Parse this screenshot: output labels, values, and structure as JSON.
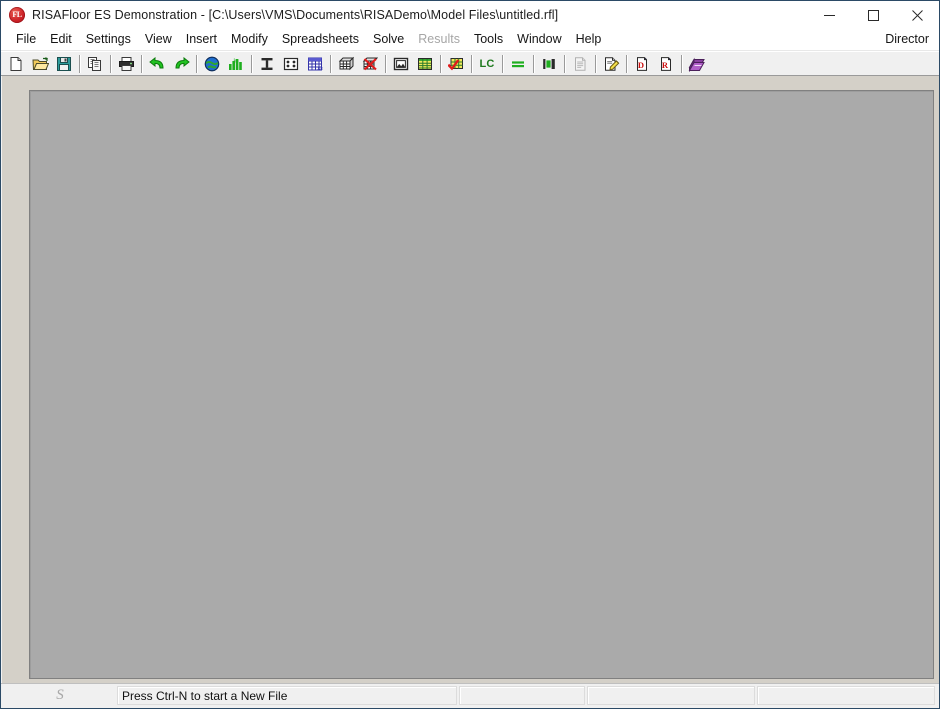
{
  "window": {
    "title": "RISAFloor ES Demonstration - [C:\\Users\\VMS\\Documents\\RISADemo\\Model Files\\untitled.rfl]",
    "logo_text": "FL",
    "controls": [
      {
        "name": "minimize-button",
        "label": "Minimize"
      },
      {
        "name": "maximize-button",
        "label": "Maximize"
      },
      {
        "name": "close-button",
        "label": "Close"
      }
    ]
  },
  "menu": {
    "items": [
      {
        "label": "File",
        "disabled": false
      },
      {
        "label": "Edit",
        "disabled": false
      },
      {
        "label": "Settings",
        "disabled": false
      },
      {
        "label": "View",
        "disabled": false
      },
      {
        "label": "Insert",
        "disabled": false
      },
      {
        "label": "Modify",
        "disabled": false
      },
      {
        "label": "Spreadsheets",
        "disabled": false
      },
      {
        "label": "Solve",
        "disabled": false
      },
      {
        "label": "Results",
        "disabled": true
      },
      {
        "label": "Tools",
        "disabled": false
      },
      {
        "label": "Window",
        "disabled": false
      },
      {
        "label": "Help",
        "disabled": false
      }
    ],
    "right_label": "Director"
  },
  "toolbar": {
    "buttons": [
      {
        "icon": "new-file-icon",
        "label": "New File"
      },
      {
        "icon": "open-folder-icon",
        "label": "Open File"
      },
      {
        "icon": "save-icon",
        "label": "Save File"
      },
      {
        "sep": true
      },
      {
        "icon": "copy-icon",
        "label": "Copy"
      },
      {
        "sep": true
      },
      {
        "icon": "print-icon",
        "label": "Print"
      },
      {
        "sep": true
      },
      {
        "icon": "undo-icon",
        "label": "Undo"
      },
      {
        "icon": "redo-icon",
        "label": "Redo"
      },
      {
        "sep": true
      },
      {
        "icon": "globe-icon",
        "label": "Global Parameters"
      },
      {
        "icon": "chart-in-icon",
        "label": "Units"
      },
      {
        "sep": true
      },
      {
        "icon": "i-beam-icon",
        "label": "Shape Database"
      },
      {
        "icon": "corner-dots-icon",
        "label": "Drawing Grid"
      },
      {
        "icon": "blue-grid-icon",
        "label": "Project Grid"
      },
      {
        "sep": true
      },
      {
        "icon": "grid-mesh-icon",
        "label": "Generate Mesh"
      },
      {
        "icon": "grid-delete-icon",
        "label": "Delete Mesh"
      },
      {
        "sep": true
      },
      {
        "icon": "framed-view-icon",
        "label": "Plot Options"
      },
      {
        "icon": "spreadsheet-icon",
        "label": "Spreadsheets"
      },
      {
        "sep": true
      },
      {
        "icon": "spreadsheet-check-icon",
        "label": "Solve"
      },
      {
        "sep": true
      },
      {
        "icon": "lc-icon",
        "label": "LC"
      },
      {
        "sep": true
      },
      {
        "icon": "equals-icon",
        "label": "Load Combinations"
      },
      {
        "sep": true
      },
      {
        "icon": "bar-graph-icon",
        "label": "Diagrams"
      },
      {
        "sep": true
      },
      {
        "icon": "document-icon",
        "label": "Report",
        "disabled": true
      },
      {
        "sep": true
      },
      {
        "icon": "document-pencil-icon",
        "label": "Detail Report"
      },
      {
        "sep": true
      },
      {
        "icon": "d-page-icon",
        "label": "D Page"
      },
      {
        "icon": "r-page-icon",
        "label": "R Page"
      },
      {
        "sep": true
      },
      {
        "icon": "help-book-icon",
        "label": "Help"
      }
    ],
    "lc_text": "LC"
  },
  "workspace": {
    "name": "mdi-client-area"
  },
  "status_bar": {
    "script_glyph": "S",
    "message": "Press Ctrl-N to start a New File",
    "panel_2": "",
    "panel_3": "",
    "panel_4": ""
  },
  "colors": {
    "accent_red": "#cc2127",
    "toolbar_bg": "#f0f0f0",
    "workspace_bg": "#d4d0c8",
    "canvas_bg": "#aaaaaa",
    "green": "#1f7a1f"
  }
}
